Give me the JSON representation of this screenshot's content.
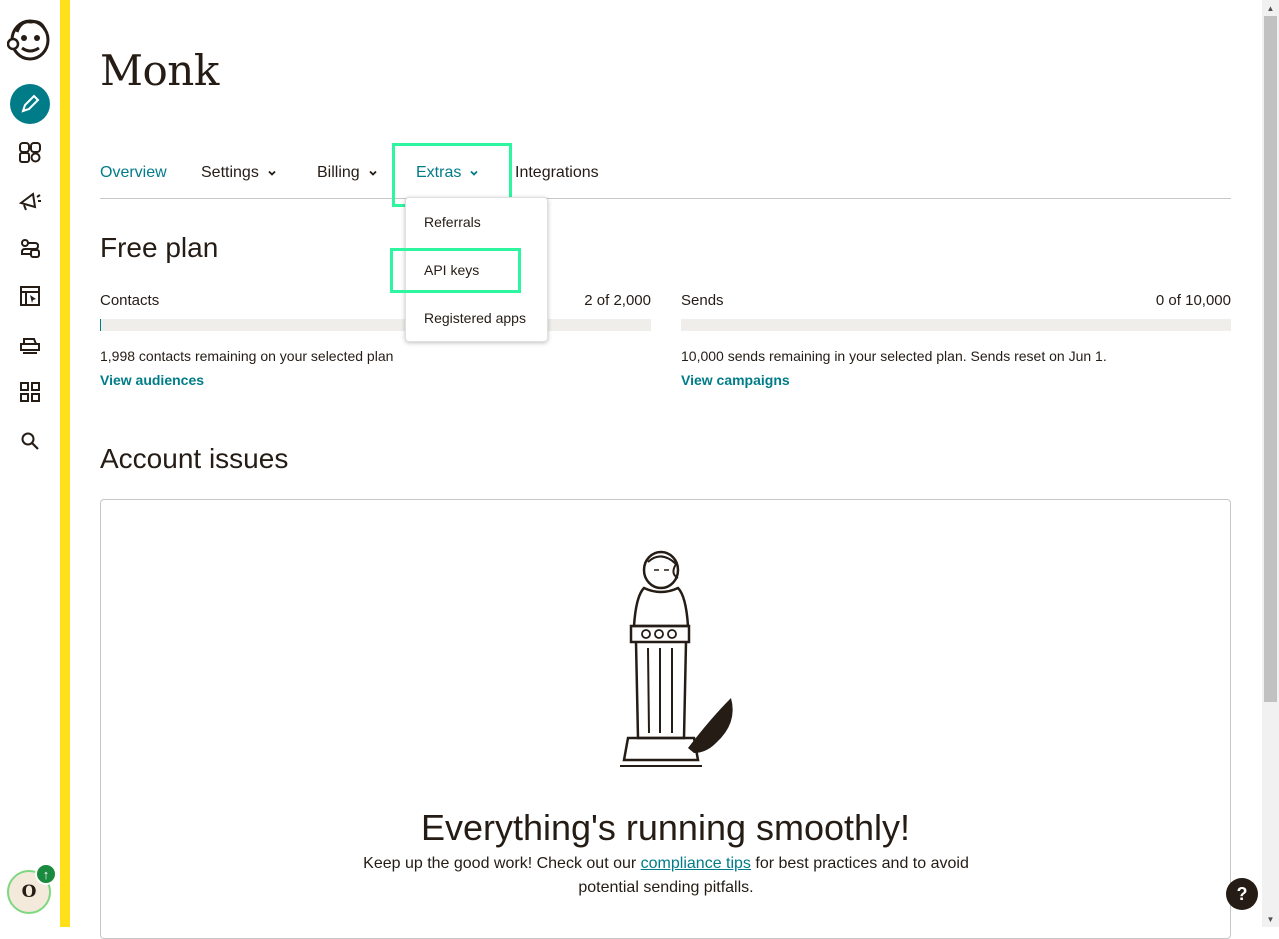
{
  "app": {
    "account_name": "Monk"
  },
  "sidebar": {
    "items": [
      {
        "name": "create",
        "icon": "pencil-icon"
      },
      {
        "name": "audience",
        "icon": "audience-icon"
      },
      {
        "name": "campaigns",
        "icon": "megaphone-icon"
      },
      {
        "name": "automations",
        "icon": "automation-icon"
      },
      {
        "name": "website",
        "icon": "website-icon"
      },
      {
        "name": "content",
        "icon": "content-icon"
      },
      {
        "name": "integrations",
        "icon": "grid-icon"
      },
      {
        "name": "search",
        "icon": "search-icon"
      }
    ],
    "avatar_initial": "O",
    "avatar_badge": "↑"
  },
  "tabs": [
    {
      "label": "Overview",
      "active": true,
      "has_chevron": false
    },
    {
      "label": "Settings",
      "active": false,
      "has_chevron": true
    },
    {
      "label": "Billing",
      "active": false,
      "has_chevron": true
    },
    {
      "label": "Extras",
      "active": true,
      "has_chevron": true
    },
    {
      "label": "Integrations",
      "active": false,
      "has_chevron": false
    }
  ],
  "extras_menu": {
    "items": [
      "Referrals",
      "API keys",
      "Registered apps"
    ]
  },
  "plan": {
    "title": "Free plan",
    "contacts": {
      "label": "Contacts",
      "count": "2 of 2,000",
      "used_fraction": 0.001,
      "remaining": "1,998 contacts remaining on your selected plan",
      "link": "View audiences"
    },
    "sends": {
      "label": "Sends",
      "count": "0 of 10,000",
      "used_fraction": 0,
      "remaining": "10,000 sends remaining in your selected plan. Sends reset on Jun 1.",
      "link": "View campaigns"
    }
  },
  "account_issues": {
    "title": "Account issues",
    "headline": "Everything's running smoothly!",
    "desc_before": "Keep up the good work! Check out our ",
    "desc_link": "compliance tips",
    "desc_after": " for best practices and to avoid potential sending pitfalls."
  },
  "help": {
    "label": "?"
  },
  "colors": {
    "accent": "#007c89",
    "brand_yellow": "#ffe01b",
    "highlight": "#2ef5a0",
    "text": "#241c15"
  }
}
